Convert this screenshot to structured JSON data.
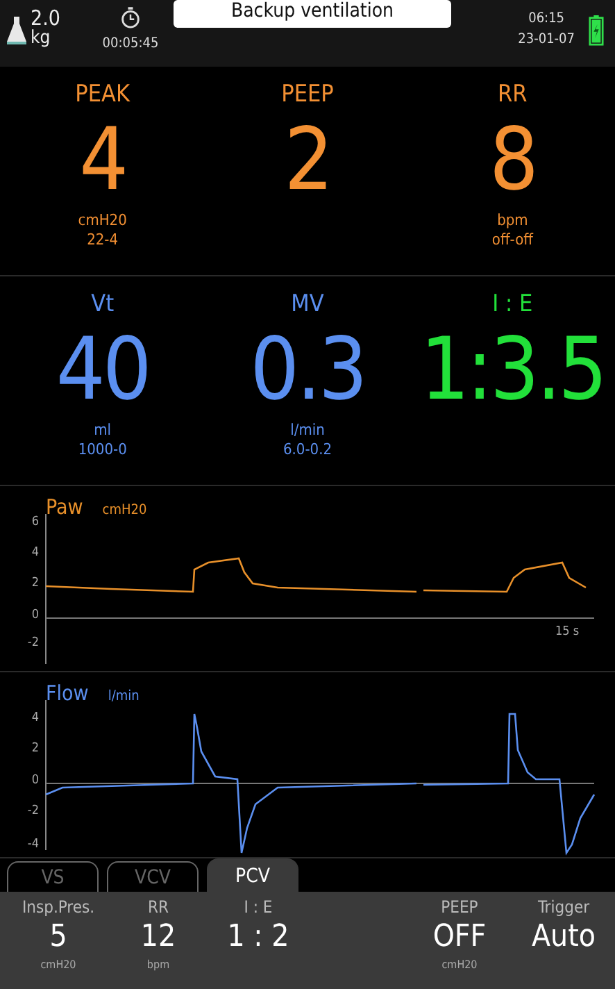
{
  "status_bar": {
    "weight": "2.0",
    "weight_unit": "kg",
    "timer": "00:05:45",
    "mode_title": "Backup ventilation",
    "time": "06:15",
    "date": "23-01-07",
    "charging": true
  },
  "metric_rows": [
    {
      "color": "#f39033",
      "metrics": [
        {
          "label": "PEAK",
          "value": "4",
          "unit": "cmH20",
          "limits": "22-4"
        },
        {
          "label": "PEEP",
          "value": "2"
        },
        {
          "label": "RR",
          "value": "8",
          "unit": "bpm",
          "limits": "off-off"
        }
      ]
    },
    {
      "color": "#5b8ff0",
      "metrics": [
        {
          "label": "Vt",
          "value": "40",
          "unit": "ml",
          "limits": "1000-0"
        },
        {
          "label": "MV",
          "value": "0.3",
          "unit": "l/min",
          "limits": "6.0-0.2"
        },
        {
          "label": "I : E",
          "value": "1:3.5",
          "color": "#22e03a"
        }
      ]
    }
  ],
  "waveforms": [
    {
      "kind": "pressure",
      "label": "Paw",
      "unit": "cmH20",
      "color": "#e8902a",
      "axis_labels": [
        "6",
        "4",
        "2",
        "0",
        "-2"
      ],
      "time_label": "15 s"
    },
    {
      "kind": "flow",
      "label": "Flow",
      "unit": "l/min",
      "color": "#5b8ff0",
      "axis_labels": [
        "4",
        "2",
        "0",
        "-2",
        "-4"
      ]
    }
  ],
  "mode_tabs": [
    {
      "label": "VS",
      "selected": false
    },
    {
      "label": "VCV",
      "selected": false
    },
    {
      "label": "PCV",
      "selected": true
    }
  ],
  "settings": [
    {
      "label": "Insp.Pres.",
      "value": "5",
      "unit": "cmH20"
    },
    {
      "label": "RR",
      "value": "12",
      "unit": "bpm"
    },
    {
      "label": "I : E",
      "value": "1 : 2"
    },
    {
      "label": "PEEP",
      "value": "OFF",
      "unit": "cmH20"
    },
    {
      "label": "Trigger",
      "value": "Auto"
    }
  ]
}
